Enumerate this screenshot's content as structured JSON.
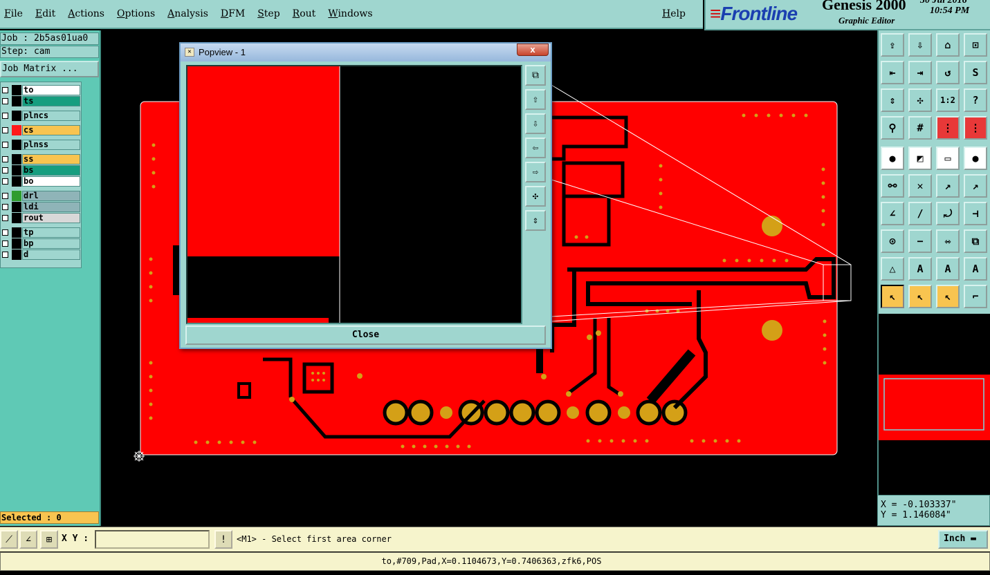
{
  "menu": [
    "File",
    "Edit",
    "Actions",
    "Options",
    "Analysis",
    "DFM",
    "Step",
    "Rout",
    "Windows"
  ],
  "help": "Help",
  "brand": {
    "logo": "Frontline",
    "product": "Genesis 2000",
    "subtitle": "Graphic Editor",
    "date": "30 Jul 2016",
    "time": "10:54 PM"
  },
  "job": {
    "job_label": "Job : 2b5as01ua0",
    "step_label": "Step: cam",
    "matrix_button": "Job Matrix ..."
  },
  "layers": [
    {
      "name": "to",
      "bg": "#ffffff",
      "swatch": "#000000"
    },
    {
      "name": "ts",
      "bg": "#169e7f",
      "swatch": "#000000"
    },
    {
      "name": "plncs",
      "bg": "#9fd6cf",
      "swatch": "#000000"
    },
    {
      "name": "cs",
      "bg": "#f8c450",
      "swatch": "#ff1a1a"
    },
    {
      "name": "plnss",
      "bg": "#9fd6cf",
      "swatch": "#000000"
    },
    {
      "name": "ss",
      "bg": "#f8c450",
      "swatch": "#000000"
    },
    {
      "name": "bs",
      "bg": "#169e7f",
      "swatch": "#000000"
    },
    {
      "name": "bo",
      "bg": "#ffffff",
      "swatch": "#000000"
    },
    {
      "name": "drl",
      "bg": "#8fb4b8",
      "swatch": "#2f9c2f"
    },
    {
      "name": "ldi",
      "bg": "#8fb4b8",
      "swatch": "#000000"
    },
    {
      "name": "rout",
      "bg": "#d8d8d8",
      "swatch": "#000000"
    },
    {
      "name": "tp",
      "bg": "#9fd6cf",
      "swatch": "#000000"
    },
    {
      "name": "bp",
      "bg": "#9fd6cf",
      "swatch": "#000000"
    },
    {
      "name": "d",
      "bg": "#9fd6cf",
      "swatch": "#000000"
    }
  ],
  "selected_label": "Selected : 0",
  "coords": {
    "x": "X = -0.103337\"",
    "y": "Y = 1.146084\""
  },
  "cmd": {
    "xy_label": "X Y :",
    "xy_value": "",
    "prompt": "<M1> - Select first area corner",
    "unit": "Inch"
  },
  "status": "to,#709,Pad,X=0.1104673,Y=0.7406363,zfk6,POS",
  "popview": {
    "title": "Popview - 1",
    "close_label": "Close",
    "close_x": "x"
  },
  "colors": {
    "copper": "#ff0000",
    "pad": "#d4a017",
    "panel": "#9fd6cf"
  },
  "toolbar_icons": [
    "zoom-home-icon",
    "zoom-back-icon",
    "home-icon",
    "zoom-box-icon",
    "pan-left-icon",
    "pan-right-icon",
    "redraw-icon",
    "pan-s-icon",
    "fit-vertical-icon",
    "fit-all-icon",
    "scale-1-2-icon",
    "help-icon",
    "measure-icon",
    "grid-icon",
    "snap-icon",
    "snap-pad-icon",
    "pad-icon",
    "line-icon",
    "ruler-icon",
    "circle-icon",
    "connect-icon",
    "cross-icon",
    "arc-cw-icon",
    "arc-ccw-icon",
    "draw-line-icon",
    "slash-icon",
    "rotate-icon",
    "mirror-icon",
    "select-pad-icon",
    "minus-icon",
    "move-icon",
    "copy-icon",
    "triangle-icon",
    "tri-a-icon",
    "tri-b-icon",
    "tri-c-icon",
    "pointer-icon",
    "select-box-icon",
    "select-alt-icon",
    "route-icon"
  ]
}
